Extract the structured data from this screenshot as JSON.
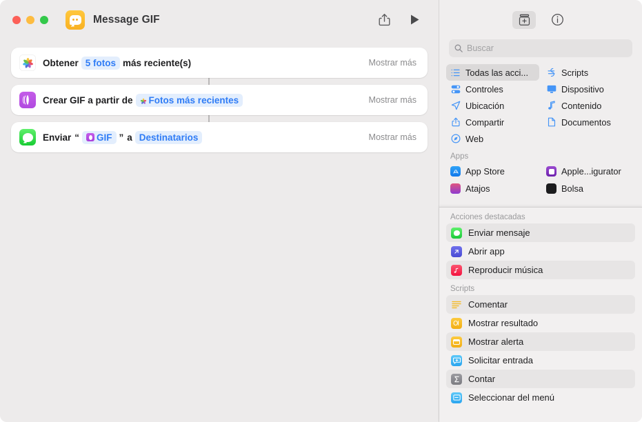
{
  "window": {
    "title": "Message GIF",
    "traffic_lights": [
      "close",
      "minimize",
      "zoom"
    ],
    "app_icon": "messages-shortcut-icon",
    "share_label": "share-icon",
    "run_label": "run-icon"
  },
  "workflow": {
    "actions": [
      {
        "icon": "photos-app-icon",
        "prefix": "Obtener",
        "token": "5 fotos",
        "token_kind": "plain",
        "suffix": "más reciente(s)",
        "show_more": "Mostrar más"
      },
      {
        "icon": "gif-media-icon",
        "prefix": "Crear GIF a partir de",
        "token": "Fotos más recientes",
        "token_kind": "photos-dot",
        "suffix": "",
        "show_more": "Mostrar más"
      },
      {
        "icon": "messages-app-icon",
        "prefix": "Enviar",
        "open_quote": "“",
        "token": "GIF",
        "token_kind": "gif-square",
        "close_quote": "”",
        "middle": "a",
        "token2": "Destinatarios",
        "show_more": "Mostrar más"
      }
    ]
  },
  "sidebar": {
    "toolbar": [
      {
        "name": "action-library-icon",
        "active": true
      },
      {
        "name": "info-icon",
        "active": false
      }
    ],
    "search": {
      "placeholder": "Buscar",
      "icon": "search-icon",
      "value": ""
    },
    "categories": [
      {
        "label": "Todas las acci...",
        "icon": "list-icon",
        "selected": true
      },
      {
        "label": "Scripts",
        "icon": "scripts-icon",
        "selected": false
      },
      {
        "label": "Controles",
        "icon": "controls-icon",
        "selected": false
      },
      {
        "label": "Dispositivo",
        "icon": "display-icon",
        "selected": false
      },
      {
        "label": "Ubicación",
        "icon": "location-arrow-icon",
        "selected": false
      },
      {
        "label": "Contenido",
        "icon": "music-note-icon",
        "selected": false
      },
      {
        "label": "Compartir",
        "icon": "share-icon",
        "selected": false
      },
      {
        "label": "Documentos",
        "icon": "document-icon",
        "selected": false
      },
      {
        "label": "Web",
        "icon": "safari-compass-icon",
        "selected": false
      }
    ],
    "apps_header": "Apps",
    "apps": [
      {
        "label": "App Store",
        "icon": "app-store-icon",
        "color": "#1f8cf5"
      },
      {
        "label": "Apple...igurator",
        "icon": "apple-configurator-icon",
        "color": "#7b2fbf"
      },
      {
        "label": "Atajos",
        "icon": "shortcuts-icon",
        "color": "#d8406b"
      },
      {
        "label": "Bolsa",
        "icon": "stocks-icon",
        "color": "#1c1c1e"
      }
    ]
  },
  "overlay": {
    "featured": {
      "header": "Acciones destacadas",
      "items": [
        {
          "label": "Enviar mensaje",
          "icon": "messages-icon",
          "color": "#2fd04a",
          "stripe": true
        },
        {
          "label": "Abrir app",
          "icon": "open-app-icon",
          "color": "#5b5ce0",
          "stripe": false
        },
        {
          "label": "Reproducir música",
          "icon": "music-icon",
          "color": "#fb2d54",
          "stripe": true
        }
      ]
    },
    "scripts": {
      "header": "Scripts",
      "items": [
        {
          "label": "Comentar",
          "icon": "comment-icon",
          "color": "#f5b921",
          "stripe": true
        },
        {
          "label": "Mostrar resultado",
          "icon": "show-result-icon",
          "color": "#f5b921",
          "stripe": false
        },
        {
          "label": "Mostrar alerta",
          "icon": "show-alert-icon",
          "color": "#f5b921",
          "stripe": true
        },
        {
          "label": "Solicitar entrada",
          "icon": "ask-input-icon",
          "color": "#3fb8f5",
          "stripe": false
        },
        {
          "label": "Contar",
          "icon": "count-sigma-icon",
          "color": "#8e8e93",
          "stripe": true
        },
        {
          "label": "Seleccionar del menú",
          "icon": "choose-menu-icon",
          "color": "#3fb8f5",
          "stripe": false
        }
      ]
    }
  },
  "colors": {
    "accent_blue": "#2f7cf6",
    "token_bg": "#e3eefd",
    "canvas": "#edebeb",
    "sidebar": "#f0eeee"
  }
}
